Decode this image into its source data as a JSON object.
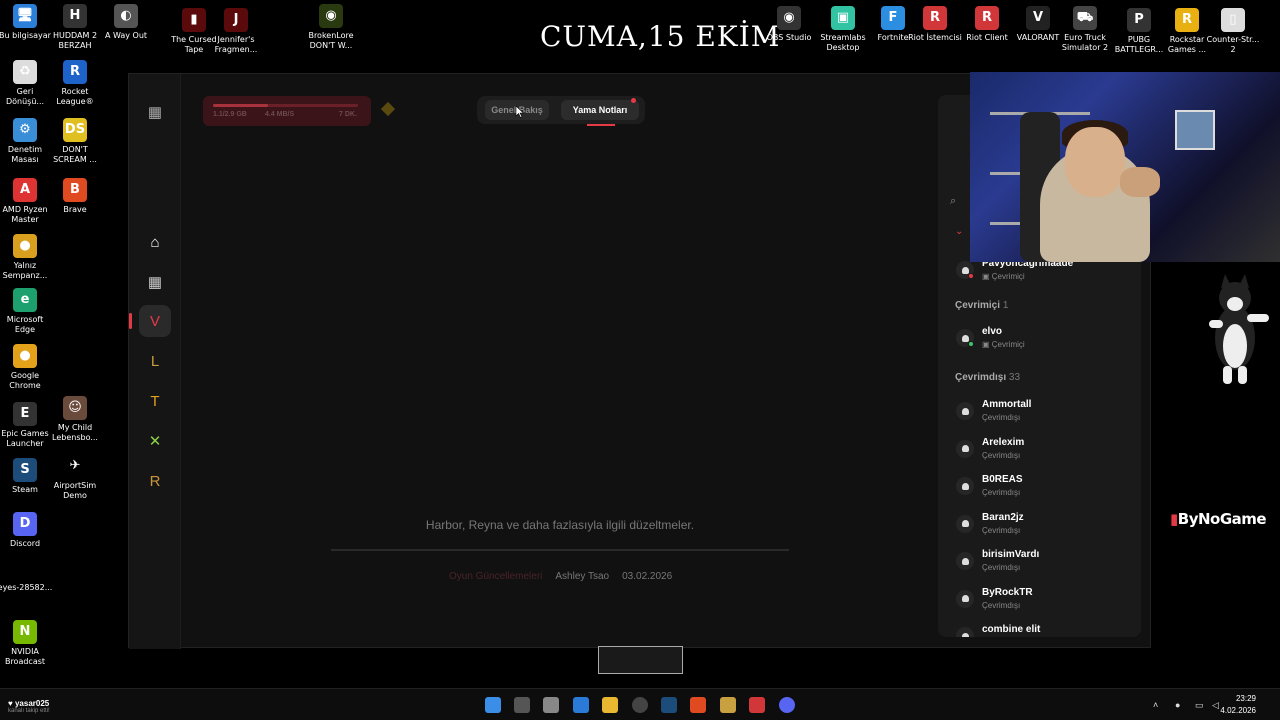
{
  "desktop": {
    "banner": "CUMA,15 EKİM",
    "icons_left": [
      {
        "label": "Bu bilgisayar",
        "glyph": "🖥",
        "color": "#2b7fd8"
      },
      {
        "label": "Geri\nDönüşü...",
        "glyph": "♻",
        "color": "#ddd"
      },
      {
        "label": "Denetim\nMasası",
        "glyph": "⚙",
        "color": "#3a8ed8"
      },
      {
        "label": "AMD Ryzen\nMaster",
        "glyph": "A",
        "color": "#d33"
      },
      {
        "label": "Yalnız\nSempanz...",
        "glyph": "●",
        "color": "#d9a020"
      },
      {
        "label": "Microsoft\nEdge",
        "glyph": "e",
        "color": "#1d9f6e"
      },
      {
        "label": "Google\nChrome",
        "glyph": "●",
        "color": "#e3a21a"
      },
      {
        "label": "Epic Games\nLauncher",
        "glyph": "E",
        "color": "#333"
      },
      {
        "label": "Steam",
        "glyph": "S",
        "color": "#1b4c7a"
      },
      {
        "label": "Discord",
        "glyph": "D",
        "color": "#5865f2"
      },
      {
        "label": "eyes-28582...",
        "glyph": "",
        "color": "#000"
      },
      {
        "label": "NVIDIA\nBroadcast",
        "glyph": "N",
        "color": "#76b900"
      }
    ],
    "icons_col2": [
      {
        "label": "HUDDAM 2\nBERZAH",
        "glyph": "H",
        "color": "#333"
      },
      {
        "label": "Rocket\nLeague®",
        "glyph": "R",
        "color": "#1e63c9"
      },
      {
        "label": "DON'T\nSCREAM ...",
        "glyph": "DS",
        "color": "#e0c020"
      },
      {
        "label": "Brave",
        "glyph": "B",
        "color": "#e04a20"
      },
      {
        "label": "My Child\nLebensbo...",
        "glyph": "☺",
        "color": "#6a4a3a"
      },
      {
        "label": "AirportSim\nDemo",
        "glyph": "✈",
        "color": "#000"
      }
    ],
    "icons_top": [
      {
        "label": "A Way Out",
        "glyph": "◐",
        "color": "#555"
      },
      {
        "label": "The Cursed\nTape",
        "glyph": "▮",
        "color": "#5a0a0a"
      },
      {
        "label": "Jennifer's\nFragmen...",
        "glyph": "J",
        "color": "#5a0a0a"
      },
      {
        "label": "BrokenLore\nDON'T W...",
        "glyph": "◉",
        "color": "#2a3a10"
      },
      {
        "label": "OBS Studio",
        "glyph": "◉",
        "color": "#333"
      },
      {
        "label": "Streamlabs\nDesktop",
        "glyph": "▣",
        "color": "#31c3a2"
      },
      {
        "label": "Fortnite",
        "glyph": "F",
        "color": "#2b8ee0"
      },
      {
        "label": "Riot İstemcisi",
        "glyph": "R",
        "color": "#d13639"
      },
      {
        "label": "Riot Client",
        "glyph": "R",
        "color": "#d13639"
      },
      {
        "label": "VALORANT",
        "glyph": "V",
        "color": "#222"
      },
      {
        "label": "Euro Truck\nSimulator 2",
        "glyph": "⛟",
        "color": "#444"
      },
      {
        "label": "PUBG\nBATTLEGR...",
        "glyph": "P",
        "color": "#333"
      },
      {
        "label": "Rockstar\nGames ...",
        "glyph": "R",
        "color": "#e8b010"
      },
      {
        "label": "Counter-Str...\n2",
        "glyph": "▯",
        "color": "#ddd"
      }
    ]
  },
  "client": {
    "download": {
      "size": "1.1/2.9 GB",
      "speed": "4.4 MB/S",
      "eta": "7 DK.",
      "progress": 0.38
    },
    "tabs": {
      "overview": "Genel Bakış",
      "patch_notes": "Yama Notları"
    },
    "patch": {
      "description": "Harbor, Reyna ve daha fazlasıyla ilgili düzeltmeler.",
      "category": "Oyun Güncellemeleri",
      "author": "Ashley Tsao",
      "date": "03.02.2026"
    },
    "rail_icons": [
      "riot-logo-icon",
      "home-icon",
      "library-icon",
      "valorant-icon",
      "lol-icon",
      "tft-icon",
      "2xko-icon",
      "runeterra-icon"
    ]
  },
  "friends": {
    "top_friend": {
      "name": "Pavyoncagrimaade",
      "status": "Çevrimiçi"
    },
    "online_label": "Çevrimiçi",
    "online_count": "1",
    "online": [
      {
        "name": "elvo",
        "status": "Çevrimiçi"
      }
    ],
    "offline_label": "Çevrimdışı",
    "offline_count": "33",
    "offline": [
      {
        "name": "Ammortall",
        "status": "Çevrimdışı"
      },
      {
        "name": "Arelexim",
        "status": "Çevrimdışı"
      },
      {
        "name": "B0REAS",
        "status": "Çevrimdışı"
      },
      {
        "name": "Baran2jz",
        "status": "Çevrimdışı"
      },
      {
        "name": "birisimVardı",
        "status": "Çevrimdışı"
      },
      {
        "name": "ByRockTR",
        "status": "Çevrimdışı"
      },
      {
        "name": "combine elit",
        "status": ""
      }
    ]
  },
  "overlay": {
    "brand": "ByNoGame"
  },
  "taskbar": {
    "user": "yasar025",
    "user_sub": "kanalı takip etti!",
    "time": "23:29",
    "date": "4.02.2026"
  }
}
